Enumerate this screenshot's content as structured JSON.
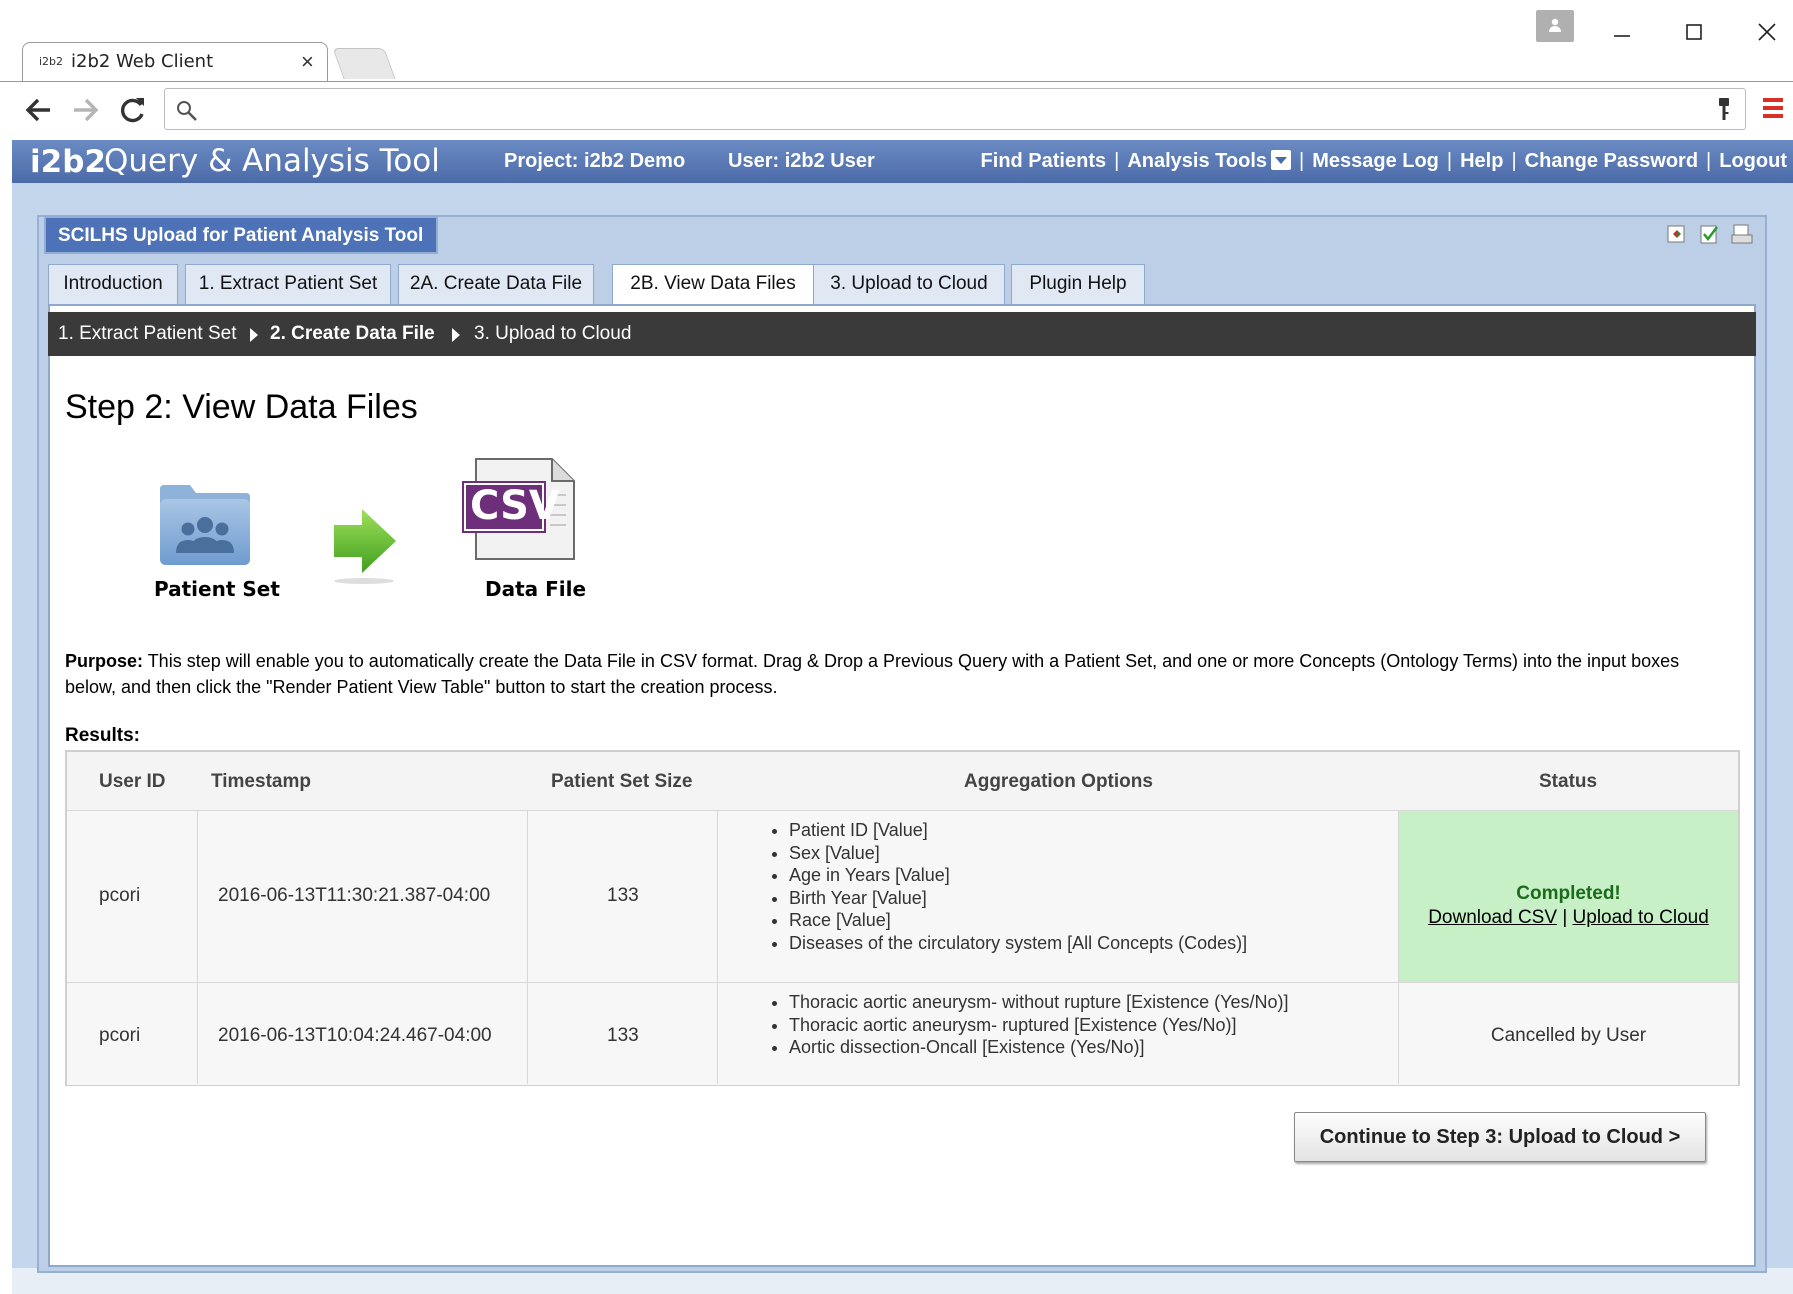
{
  "browser": {
    "tab_title": "i2b2 Web Client",
    "tab_favicon_text": "i2b2",
    "address_value": "",
    "address_placeholder": ""
  },
  "app": {
    "logo": "i2b2",
    "name": "Query & Analysis Tool",
    "project": "Project: i2b2 Demo",
    "user": "User: i2b2 User",
    "nav": {
      "find_patients": "Find Patients",
      "analysis_tools": "Analysis Tools",
      "message_log": "Message Log",
      "help": "Help",
      "change_password": "Change Password",
      "logout": "Logout",
      "separator": "|"
    },
    "header_color": "#4b6aa8"
  },
  "plugin": {
    "title": "SCILHS Upload for Patient Analysis Tool",
    "tabs": [
      {
        "label": "Introduction"
      },
      {
        "label": "1. Extract Patient Set"
      },
      {
        "label": "2A. Create Data File"
      },
      {
        "label": "2B. View Data Files",
        "active": true
      },
      {
        "label": "3. Upload to Cloud"
      },
      {
        "label": "Plugin Help"
      }
    ],
    "breadcrumb": [
      {
        "label": "1. Extract Patient Set"
      },
      {
        "label": "2. Create Data File",
        "current": true
      },
      {
        "label": "3. Upload to Cloud"
      }
    ]
  },
  "main": {
    "step_title": "Step 2: View Data Files",
    "flow": {
      "patient_set_label": "Patient Set",
      "data_file_label": "Data File",
      "csv_badge": "CSV"
    },
    "purpose_label": "Purpose:",
    "purpose_text": " This step will enable you to automatically create the Data File in CSV format. Drag & Drop a Previous Query with a Patient Set, and one or more Concepts (Ontology Terms) into the input boxes below, and then click the \"Render Patient View Table\" button to start the creation process.",
    "results_label": "Results:",
    "table": {
      "headers": {
        "user_id": "User ID",
        "timestamp": "Timestamp",
        "size": "Patient Set Size",
        "aggregation": "Aggregation Options",
        "status": "Status"
      },
      "rows": [
        {
          "user_id": "pcori",
          "timestamp": "2016-06-13T11:30:21.387-04:00",
          "size": "133",
          "aggregation": [
            "Patient ID [Value]",
            "Sex [Value]",
            "Age in Years [Value]",
            "Birth Year [Value]",
            "Race [Value]",
            "Diseases of the circulatory system [All Concepts (Codes)]"
          ],
          "status": "Completed!",
          "download_link": "Download CSV",
          "link_sep": "|",
          "upload_link": "Upload to Cloud"
        },
        {
          "user_id": "pcori",
          "timestamp": "2016-06-13T10:04:24.467-04:00",
          "size": "133",
          "aggregation": [
            "Thoracic aortic aneurysm- without rupture [Existence (Yes/No)]",
            "Thoracic aortic aneurysm- ruptured [Existence (Yes/No)]",
            "Aortic dissection-Oncall [Existence (Yes/No)]"
          ],
          "status": "Cancelled by User"
        }
      ]
    },
    "continue_button": "Continue to Step 3: Upload to Cloud >"
  },
  "icons": [
    "back-icon",
    "forward-icon",
    "reload-icon",
    "search-icon",
    "key-icon",
    "menu-icon",
    "profile-icon",
    "minimize-icon",
    "maximize-icon",
    "close-icon",
    "folder-people-icon",
    "arrow-right-icon",
    "csv-file-icon",
    "export-icon",
    "check-icon",
    "print-icon"
  ],
  "colors": {
    "status_completed_bg": "#c7f0c7",
    "breadcrumb_bg": "#3a3a3a",
    "panel_tab_bg": "#4d72b8"
  }
}
